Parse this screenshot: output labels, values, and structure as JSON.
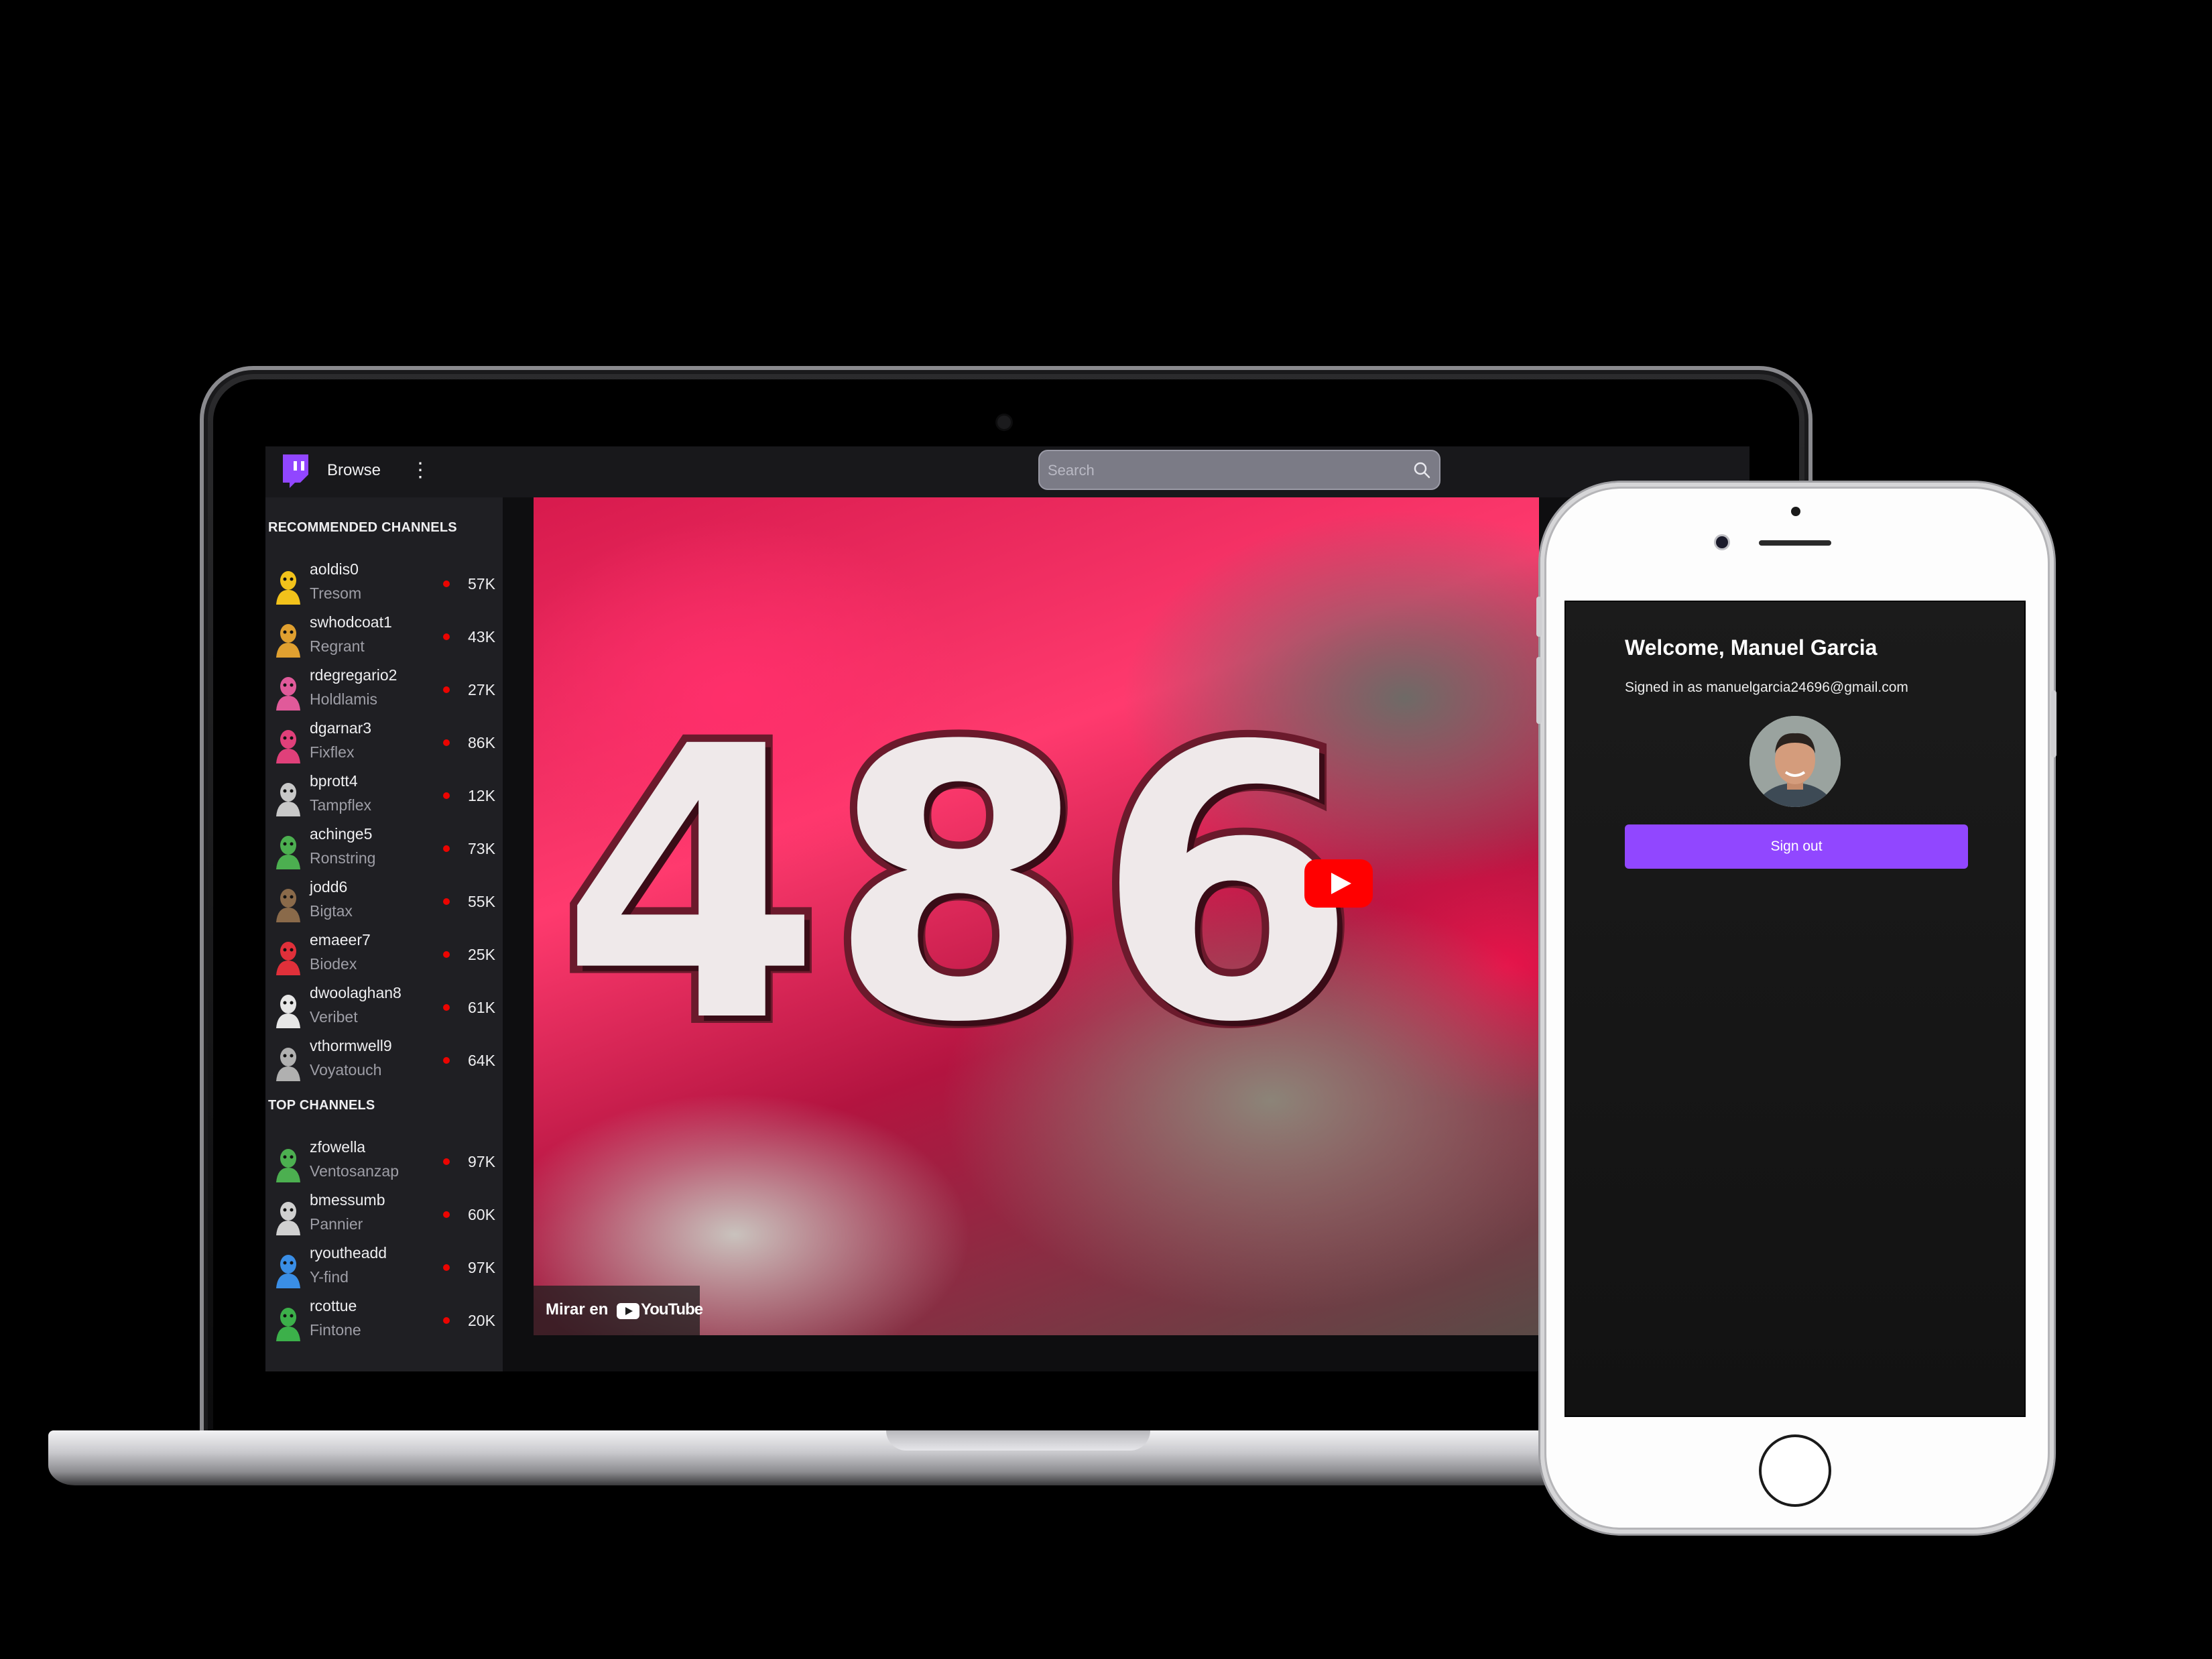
{
  "laptop": {
    "topbar": {
      "browse_label": "Browse",
      "search_placeholder": "Search"
    },
    "sidebar": {
      "recommended_heading": "RECOMMENDED CHANNELS",
      "recommended": [
        {
          "name": "aoldis0",
          "game": "Tresom",
          "viewers": "57K",
          "avatar_color": "#f2c21b"
        },
        {
          "name": "swhodcoat1",
          "game": "Regrant",
          "viewers": "43K",
          "avatar_color": "#e0a030"
        },
        {
          "name": "rdegregario2",
          "game": "Holdlamis",
          "viewers": "27K",
          "avatar_color": "#e05a9a"
        },
        {
          "name": "dgarnar3",
          "game": "Fixflex",
          "viewers": "86K",
          "avatar_color": "#e0407a"
        },
        {
          "name": "bprott4",
          "game": "Tampflex",
          "viewers": "12K",
          "avatar_color": "#c8c8c8"
        },
        {
          "name": "achinge5",
          "game": "Ronstring",
          "viewers": "73K",
          "avatar_color": "#4caf50"
        },
        {
          "name": "jodd6",
          "game": "Bigtax",
          "viewers": "55K",
          "avatar_color": "#8a6a4a"
        },
        {
          "name": "emaeer7",
          "game": "Biodex",
          "viewers": "25K",
          "avatar_color": "#e0303a"
        },
        {
          "name": "dwoolaghan8",
          "game": "Veribet",
          "viewers": "61K",
          "avatar_color": "#e6e6e6"
        },
        {
          "name": "vthormwell9",
          "game": "Voyatouch",
          "viewers": "64K",
          "avatar_color": "#b0b0b0"
        }
      ],
      "top_heading": "TOP CHANNELS",
      "top": [
        {
          "name": "zfowella",
          "game": "Ventosanzap",
          "viewers": "97K",
          "avatar_color": "#4caf50"
        },
        {
          "name": "bmessumb",
          "game": "Pannier",
          "viewers": "60K",
          "avatar_color": "#d0d0d0"
        },
        {
          "name": "ryoutheadd",
          "game": "Y-find",
          "viewers": "97K",
          "avatar_color": "#3a8ee6"
        },
        {
          "name": "rcottue",
          "game": "Fintone",
          "viewers": "20K",
          "avatar_color": "#3cb04a"
        }
      ]
    },
    "video": {
      "thumbnail_text": "486",
      "watch_on_label": "Mirar en",
      "youtube_label": "YouTube"
    }
  },
  "phone": {
    "welcome_title": "Welcome, Manuel Garcia",
    "signed_in_text": "Signed in as manuelgarcia24696@gmail.com",
    "signout_label": "Sign out"
  },
  "colors": {
    "accent": "#9147ff",
    "live": "#eb0400",
    "twitch_purple": "#9146ff"
  }
}
